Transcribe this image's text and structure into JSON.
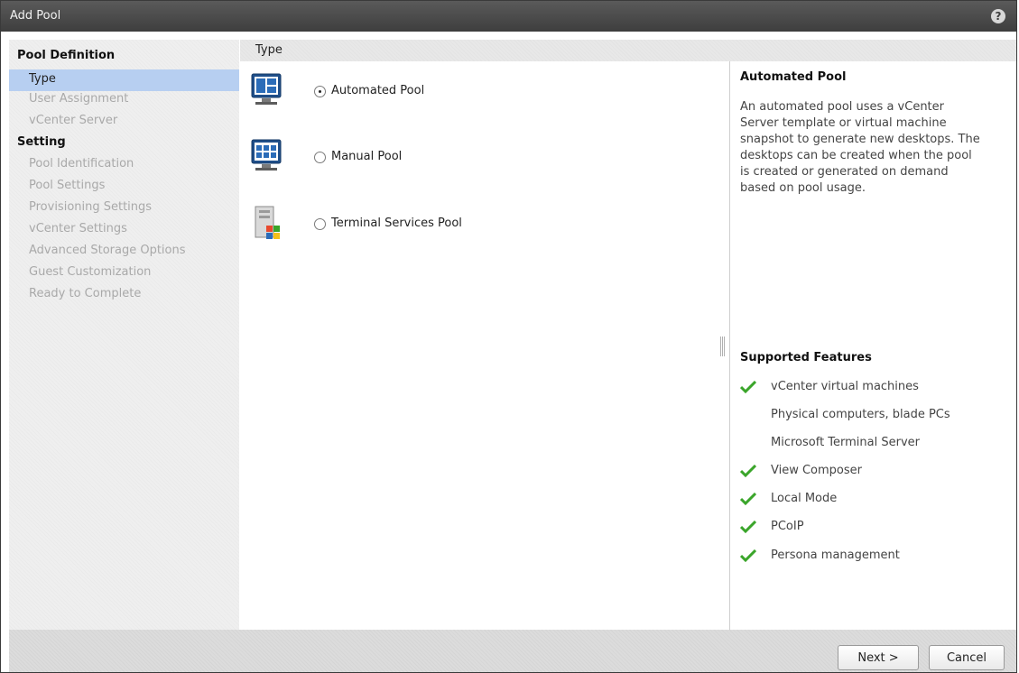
{
  "window": {
    "title": "Add Pool",
    "help_icon": "?"
  },
  "sidebar": {
    "sections": [
      {
        "heading": "Pool Definition",
        "items": [
          "Type",
          "User Assignment",
          "vCenter Server"
        ]
      },
      {
        "heading": "Setting",
        "items": [
          "Pool Identification",
          "Pool Settings",
          "Provisioning Settings",
          "vCenter Settings",
          "Advanced Storage Options",
          "Guest Customization",
          "Ready to Complete"
        ]
      }
    ],
    "selected": "Type"
  },
  "content": {
    "header": "Type",
    "options": [
      {
        "label": "Automated Pool",
        "selected": true,
        "icon": "automated-pool-monitor-icon"
      },
      {
        "label": "Manual Pool",
        "selected": false,
        "icon": "manual-pool-monitor-icon"
      },
      {
        "label": "Terminal Services Pool",
        "selected": false,
        "icon": "terminal-server-icon"
      }
    ]
  },
  "details": {
    "title": "Automated Pool",
    "description": "An automated pool uses a vCenter Server template or virtual machine snapshot to generate new desktops. The desktops can be created when the pool is created or generated on demand based on pool usage.",
    "features_title": "Supported Features",
    "features": [
      {
        "label": "vCenter virtual machines",
        "supported": true
      },
      {
        "label": "Physical computers, blade PCs",
        "supported": false
      },
      {
        "label": "Microsoft Terminal Server",
        "supported": false
      },
      {
        "label": "View Composer",
        "supported": true
      },
      {
        "label": "Local Mode",
        "supported": true
      },
      {
        "label": "PCoIP",
        "supported": true
      },
      {
        "label": "Persona management",
        "supported": true
      }
    ]
  },
  "footer": {
    "next_label": "Next >",
    "cancel_label": "Cancel"
  },
  "colors": {
    "selection": "#b7cff1",
    "check": "#3aa52a",
    "titlebar": "#4a4a4a"
  }
}
